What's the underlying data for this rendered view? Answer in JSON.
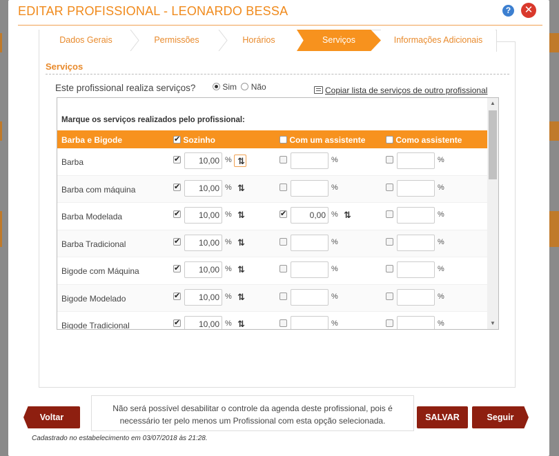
{
  "header": {
    "title": "EDITAR PROFISSIONAL - LEONARDO BESSA",
    "help_icon": "?",
    "close_icon": "✕"
  },
  "tabs": [
    {
      "label": "Dados Gerais"
    },
    {
      "label": "Permissões"
    },
    {
      "label": "Horários"
    },
    {
      "label": "Serviços"
    },
    {
      "label": "Informações Adicionais"
    }
  ],
  "section": {
    "title": "Serviços",
    "question": "Este profissional realiza serviços?",
    "option_yes": "Sim",
    "option_no": "Não",
    "selected": "Sim",
    "copy_link": "Copiar lista de serviços de outro profissional"
  },
  "table": {
    "instruction": "Marque os serviços realizados pelo profissional:",
    "headers": {
      "group": "Barba e Bigode",
      "alone": "Sozinho",
      "with_assistant": "Com um assistente",
      "as_assistant": "Como assistente"
    },
    "percent": "%",
    "rows": [
      {
        "name": "Barba",
        "alone": "10,00",
        "with_assistant": "",
        "as_assistant": ""
      },
      {
        "name": "Barba com máquina",
        "alone": "10,00",
        "with_assistant": "",
        "as_assistant": ""
      },
      {
        "name": "Barba Modelada",
        "alone": "10,00",
        "with_assistant": "0,00",
        "as_assistant": ""
      },
      {
        "name": "Barba Tradicional",
        "alone": "10,00",
        "with_assistant": "",
        "as_assistant": ""
      },
      {
        "name": "Bigode com Máquina",
        "alone": "10,00",
        "with_assistant": "",
        "as_assistant": ""
      },
      {
        "name": "Bigode Modelado",
        "alone": "10,00",
        "with_assistant": "",
        "as_assistant": ""
      },
      {
        "name": "Bigode Tradicional",
        "alone": "10,00",
        "with_assistant": "",
        "as_assistant": ""
      }
    ]
  },
  "notice": "Não será possível desabilitar o controle da agenda deste profissional, pois é necessário ter pelo menos um Profissional com esta opção selecionada.",
  "buttons": {
    "back": "Voltar",
    "save": "SALVAR",
    "next": "Seguir"
  },
  "footer": "Cadastrado no estabelecimento em 03/07/2018 às 21:28."
}
